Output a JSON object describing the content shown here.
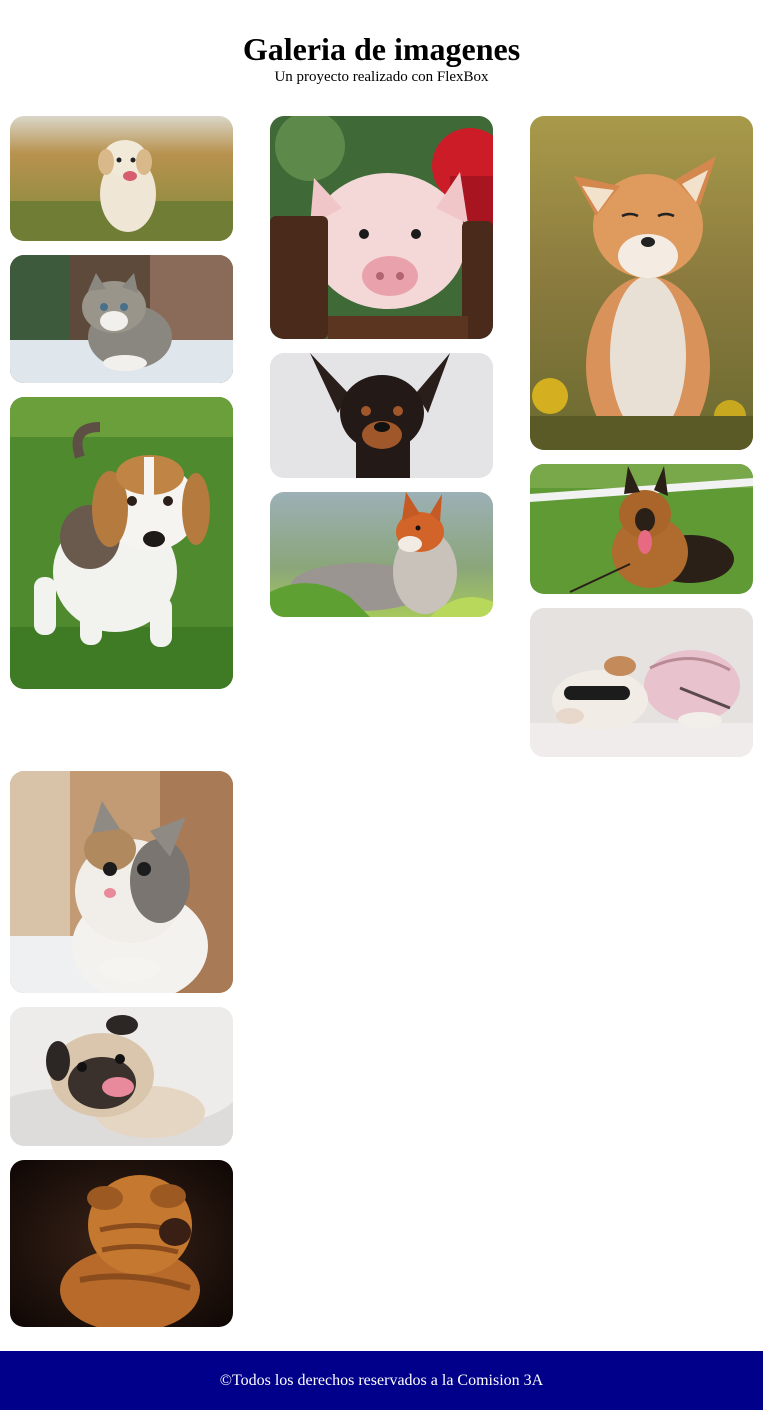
{
  "header": {
    "title": "Galeria de imagenes",
    "subtitle": "Un proyecto realizado con FlexBox"
  },
  "gallery": {
    "photos": [
      {
        "subject": "golden retriever puppy running on grass",
        "icon": "puppy-photo"
      },
      {
        "subject": "grey tabby kitten",
        "icon": "kitten-photo"
      },
      {
        "subject": "beagle puppy on grass",
        "icon": "beagle-photo"
      },
      {
        "subject": "pink piglet behind wooden fence",
        "icon": "piglet-photo"
      },
      {
        "subject": "miniature pinscher",
        "icon": "pinscher-photo"
      },
      {
        "subject": "fox lying in grass",
        "icon": "fox-photo"
      },
      {
        "subject": "red fox sitting with eyes closed",
        "icon": "fox-photo"
      },
      {
        "subject": "german shepherd lying on grass",
        "icon": "shepherd-photo"
      },
      {
        "subject": "bulldog with sunglasses and pink hoodie",
        "icon": "bulldog-photo"
      },
      {
        "subject": "white and tabby kitten",
        "icon": "kitten-photo"
      },
      {
        "subject": "pug laughing on blanket",
        "icon": "pug-photo"
      },
      {
        "subject": "shar pei puppy",
        "icon": "sharpei-photo"
      }
    ]
  },
  "footer": {
    "text": "©Todos los derechos reservados a la Comision 3A",
    "background": "#00008b"
  }
}
